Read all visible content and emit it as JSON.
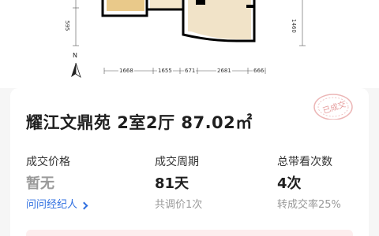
{
  "floor_plan": {
    "dim_left": "595",
    "dim_right": "1460",
    "compass": "N",
    "scale_dims": [
      "1668",
      "1655",
      "671",
      "2681",
      "666"
    ]
  },
  "stamp_text": "已成交",
  "listing": {
    "title": "耀江文鼎苑 2室2厅 87.02㎡"
  },
  "stats": {
    "price": {
      "label": "成交价格",
      "value": "暂无",
      "link": "问问经纪人"
    },
    "period": {
      "label": "成交周期",
      "value": "81天",
      "sub": "共调价1次"
    },
    "views": {
      "label": "总带看次数",
      "value": "4次",
      "sub": "转成交率25%"
    }
  },
  "colors": {
    "link": "#2f6fe0",
    "stamp": "#e8a0a0",
    "wall": "#000000",
    "floor_wood": "#e9c98a",
    "floor_tile": "#f1e3c8"
  }
}
